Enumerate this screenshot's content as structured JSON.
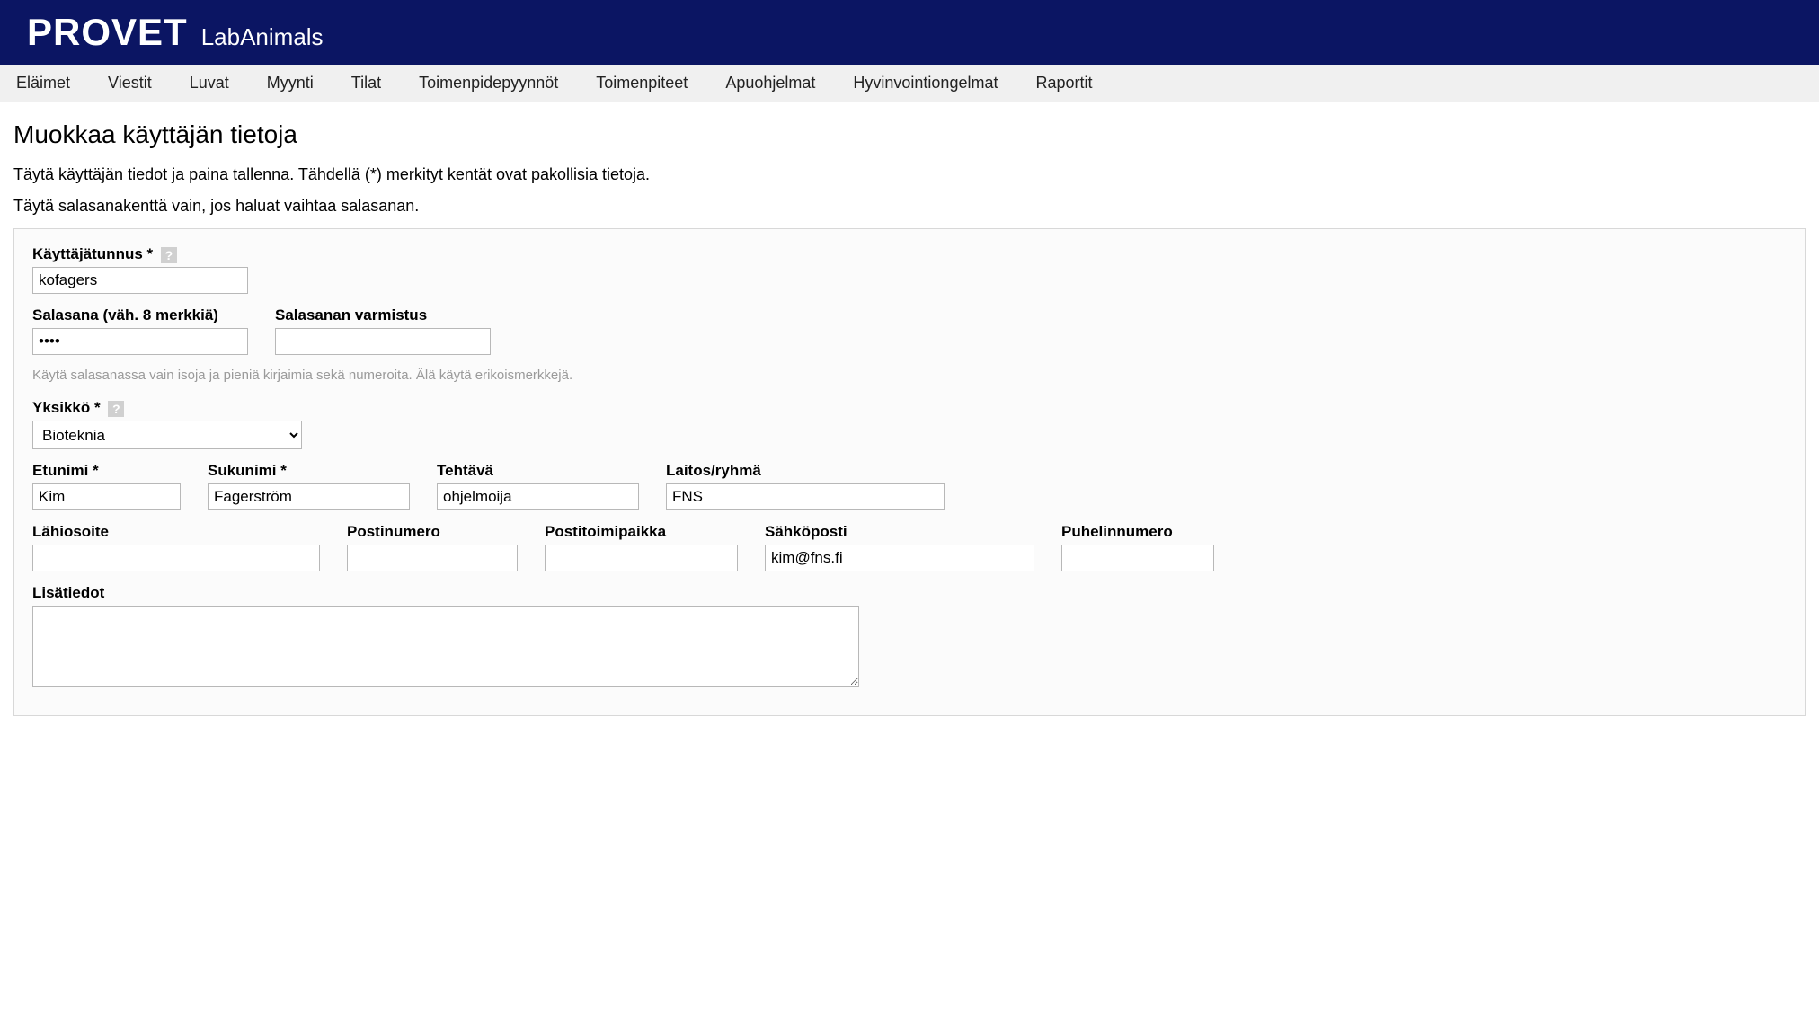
{
  "header": {
    "brand": "PROVET",
    "sub": "LabAnimals"
  },
  "nav": {
    "items": [
      "Eläimet",
      "Viestit",
      "Luvat",
      "Myynti",
      "Tilat",
      "Toimenpidepyynnöt",
      "Toimenpiteet",
      "Apuohjelmat",
      "Hyvinvointiongelmat",
      "Raportit"
    ]
  },
  "page": {
    "title": "Muokkaa käyttäjän tietoja",
    "instr1": "Täytä käyttäjän tiedot ja paina tallenna. Tähdellä (*) merkityt kentät ovat pakollisia tietoja.",
    "instr2": "Täytä salasanakenttä vain, jos haluat vaihtaa salasanan."
  },
  "form": {
    "username": {
      "label": "Käyttäjätunnus *",
      "value": "kofagers"
    },
    "password": {
      "label": "Salasana (väh. 8 merkkiä)",
      "value": "••••"
    },
    "password_confirm": {
      "label": "Salasanan varmistus",
      "value": ""
    },
    "password_hint": "Käytä salasanassa vain isoja ja pieniä kirjaimia sekä numeroita. Älä käytä erikoismerkkejä.",
    "unit": {
      "label": "Yksikkö *",
      "value": "Bioteknia"
    },
    "firstname": {
      "label": "Etunimi *",
      "value": "Kim"
    },
    "lastname": {
      "label": "Sukunimi *",
      "value": "Fagerström"
    },
    "role": {
      "label": "Tehtävä",
      "value": "ohjelmoija"
    },
    "department": {
      "label": "Laitos/ryhmä",
      "value": "FNS"
    },
    "address": {
      "label": "Lähiosoite",
      "value": ""
    },
    "postalcode": {
      "label": "Postinumero",
      "value": ""
    },
    "city": {
      "label": "Postitoimipaikka",
      "value": ""
    },
    "email": {
      "label": "Sähköposti",
      "value": "kim@fns.fi"
    },
    "phone": {
      "label": "Puhelinnumero",
      "value": ""
    },
    "notes": {
      "label": "Lisätiedot",
      "value": ""
    },
    "help_icon": "?"
  }
}
